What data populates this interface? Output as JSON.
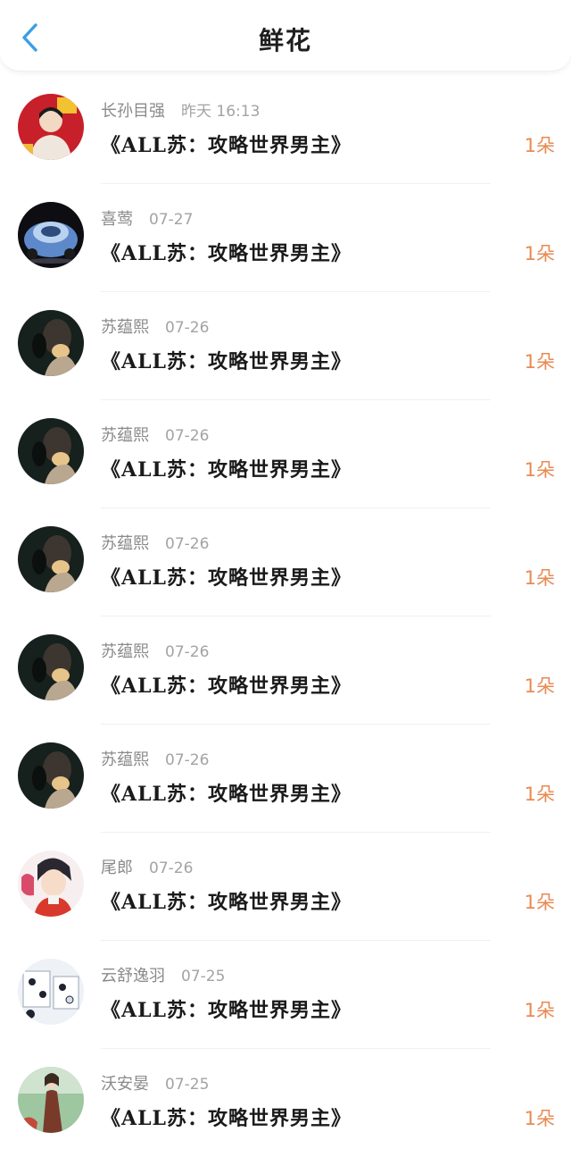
{
  "header": {
    "title": "鲜花"
  },
  "colors": {
    "accent": "#3a9ee6",
    "quantity": "#e88a52"
  },
  "records": [
    {
      "user": "长孙目强",
      "time": "昨天 16:13",
      "book": "《ALL苏：攻略世界男主》",
      "qty": "1朵",
      "avatar": "avatar-red-portrait"
    },
    {
      "user": "喜莺",
      "time": "07-27",
      "book": "《ALL苏：攻略世界男主》",
      "qty": "1朵",
      "avatar": "avatar-blue-car"
    },
    {
      "user": "苏蕴熙",
      "time": "07-26",
      "book": "《ALL苏：攻略世界男主》",
      "qty": "1朵",
      "avatar": "avatar-dark-portrait"
    },
    {
      "user": "苏蕴熙",
      "time": "07-26",
      "book": "《ALL苏：攻略世界男主》",
      "qty": "1朵",
      "avatar": "avatar-dark-portrait"
    },
    {
      "user": "苏蕴熙",
      "time": "07-26",
      "book": "《ALL苏：攻略世界男主》",
      "qty": "1朵",
      "avatar": "avatar-dark-portrait"
    },
    {
      "user": "苏蕴熙",
      "time": "07-26",
      "book": "《ALL苏：攻略世界男主》",
      "qty": "1朵",
      "avatar": "avatar-dark-portrait"
    },
    {
      "user": "苏蕴熙",
      "time": "07-26",
      "book": "《ALL苏：攻略世界男主》",
      "qty": "1朵",
      "avatar": "avatar-dark-portrait"
    },
    {
      "user": "尾郎",
      "time": "07-26",
      "book": "《ALL苏：攻略世界男主》",
      "qty": "1朵",
      "avatar": "avatar-anime-boy"
    },
    {
      "user": "云舒逸羽",
      "time": "07-25",
      "book": "《ALL苏：攻略世界男主》",
      "qty": "1朵",
      "avatar": "avatar-go-board"
    },
    {
      "user": "沃安晏",
      "time": "07-25",
      "book": "《ALL苏：攻略世界男主》",
      "qty": "1朵",
      "avatar": "avatar-girl-dress"
    }
  ]
}
